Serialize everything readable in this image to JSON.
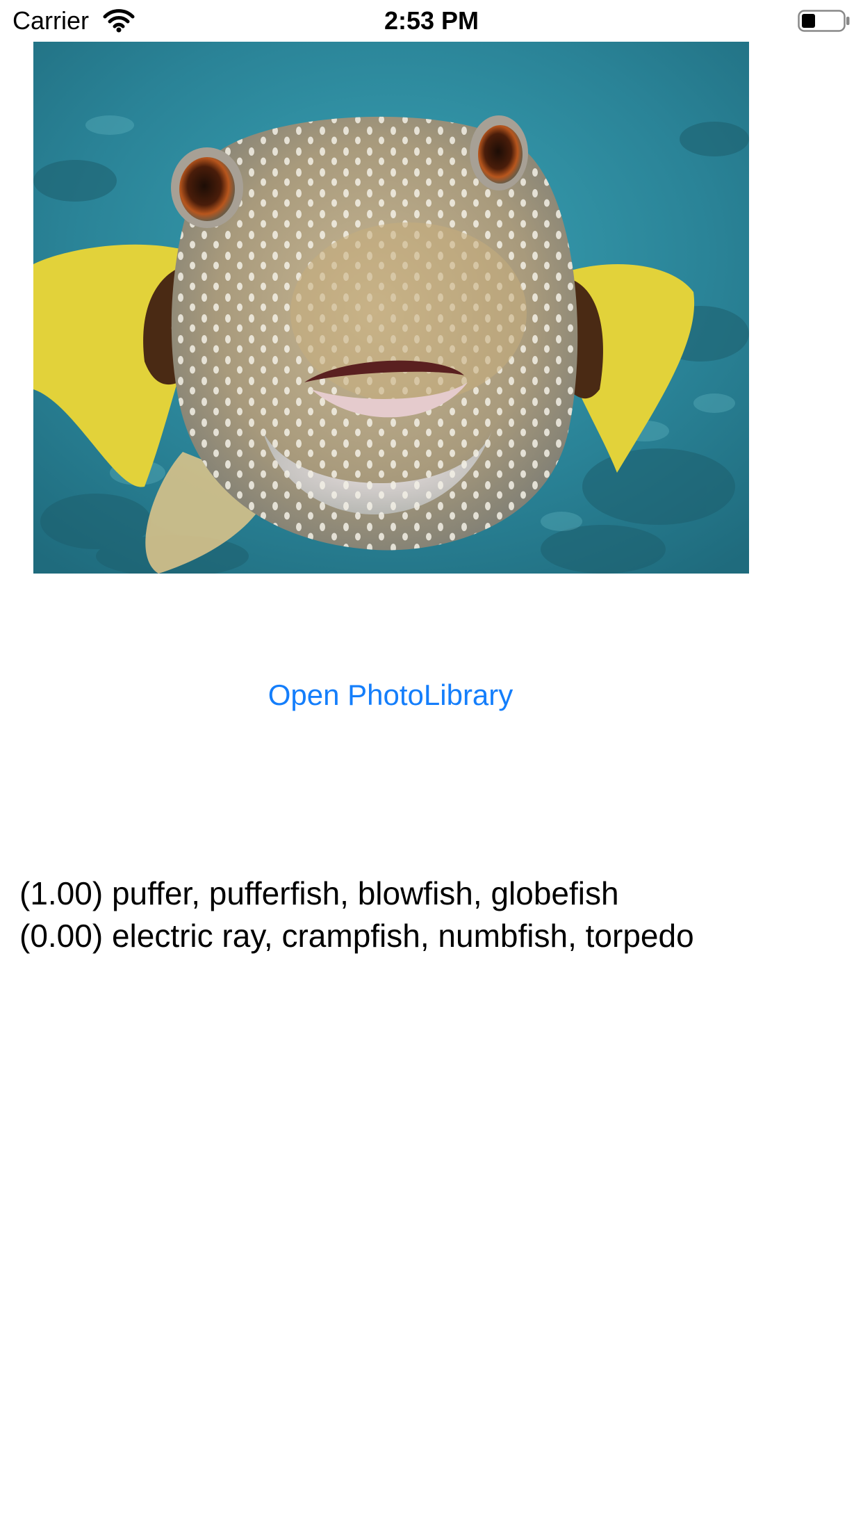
{
  "status_bar": {
    "carrier": "Carrier",
    "time": "2:53 PM",
    "wifi_icon": "wifi-icon",
    "battery_icon": "battery-icon",
    "battery_level": 0.35
  },
  "photo": {
    "subject": "pufferfish underwater",
    "colors": {
      "water": "#2f8ea3",
      "body": "#b7a98a",
      "fins": "#e2d23a"
    }
  },
  "actions": {
    "open_library_label": "Open PhotoLibrary",
    "accent_color": "#147efb"
  },
  "results": [
    {
      "text": "(1.00) puffer, pufferfish, blowfish, globefish"
    },
    {
      "text": "(0.00) electric ray, crampfish, numbfish, torpedo"
    }
  ]
}
